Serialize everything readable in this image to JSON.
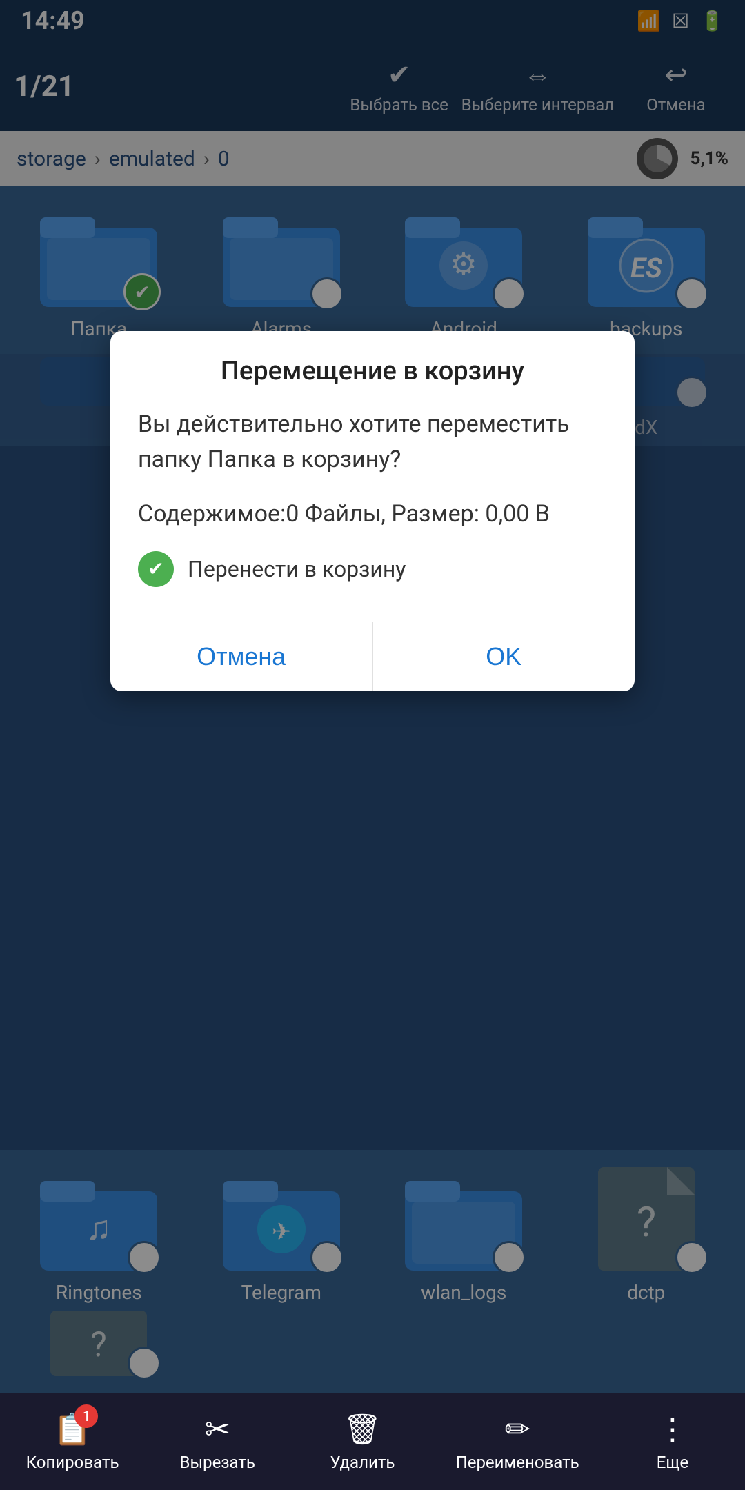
{
  "statusBar": {
    "time": "14:49",
    "icons": [
      "wifi",
      "close-box",
      "battery"
    ]
  },
  "toolbar": {
    "count": "1/21",
    "selectAll": "Выбрать все",
    "selectRange": "Выберите интервал",
    "cancel": "Отмена"
  },
  "breadcrumb": {
    "path": [
      "storage",
      "emulated",
      "0"
    ],
    "storagePercent": "5,1%"
  },
  "fileGrid": {
    "row1": [
      {
        "name": "Папка",
        "selected": true,
        "type": "plain"
      },
      {
        "name": "Alarms",
        "selected": false,
        "type": "plain"
      },
      {
        "name": "Android",
        "selected": false,
        "type": "gear"
      },
      {
        "name": "backups",
        "selected": false,
        "type": "es"
      }
    ],
    "row2_partial": [
      {
        "name": "...",
        "selected": false,
        "type": "plain"
      },
      {
        "name": "...",
        "selected": false,
        "type": "plain"
      },
      {
        "name": "...",
        "selected": false,
        "type": "plain"
      },
      {
        "name": "dX",
        "selected": false,
        "type": "plain"
      }
    ],
    "rowBottom": [
      {
        "name": "Ringtones",
        "selected": false,
        "type": "music"
      },
      {
        "name": "Telegram",
        "selected": false,
        "type": "telegram"
      },
      {
        "name": "wlan_logs",
        "selected": false,
        "type": "plain"
      },
      {
        "name": "dctp",
        "selected": false,
        "type": "unknown"
      }
    ],
    "rowLast": [
      {
        "name": "",
        "selected": false,
        "type": "unknown"
      }
    ]
  },
  "dialog": {
    "title": "Перемещение в корзину",
    "message": "Вы действительно хотите переместить папку Папка в корзину?",
    "details": "Содержимое:0 Файлы, Размер: 0,00 В",
    "checkLabel": "Перенести в корзину",
    "cancelBtn": "Отмена",
    "okBtn": "OK"
  },
  "bottomToolbar": {
    "copy": "Копировать",
    "cut": "Вырезать",
    "delete": "Удалить",
    "rename": "Переименовать",
    "more": "Еще",
    "copyBadge": "1"
  }
}
